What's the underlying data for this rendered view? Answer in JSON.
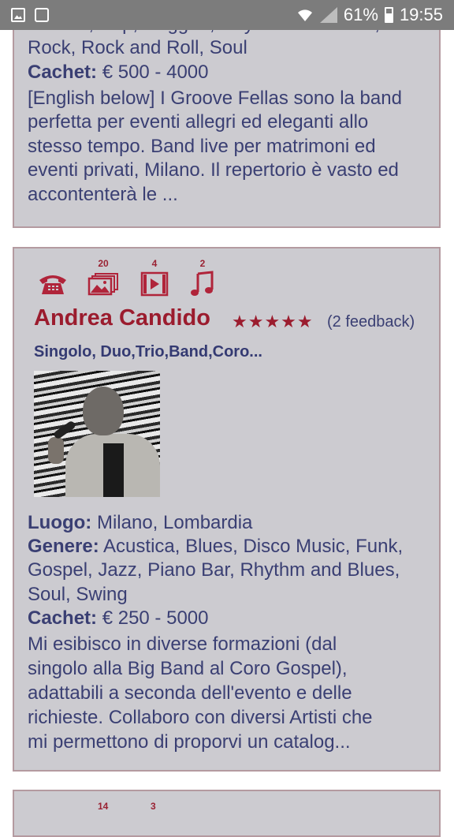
{
  "statusbar": {
    "battery_pct": "61%",
    "time": "19:55"
  },
  "card1": {
    "genre_tail": "Italiana, Pop, Reggae, Rhythm and Blues,",
    "genre_line2": "Rock, Rock and Roll, Soul",
    "cachet_label": "Cachet:",
    "cachet_value": "€ 500 - 4000",
    "desc_lines": [
      "[English below] I Groove Fellas sono la band",
      "perfetta per eventi allegri ed eleganti allo",
      "stesso tempo. Band live per matrimoni ed",
      "eventi privati, Milano. Il repertorio è vasto ed",
      "accontenterà le ..."
    ]
  },
  "card2": {
    "icons": [
      {
        "name": "phone-icon",
        "count": ""
      },
      {
        "name": "photos-icon",
        "count": "20"
      },
      {
        "name": "video-icon",
        "count": "4"
      },
      {
        "name": "music-note-icon",
        "count": "2"
      }
    ],
    "name": "Andrea Candido",
    "rating": 5,
    "stars": "★★★★★",
    "feedback": "(2 feedback)",
    "formations": "Singolo, Duo,Trio,Band,Coro...",
    "luogo_label": "Luogo:",
    "luogo_value": "Milano, Lombardia",
    "genere_label": "Genere:",
    "genere_line1": "Acustica, Blues, Disco Music, Funk,",
    "genere_line2": "Gospel, Jazz, Piano Bar, Rhythm and Blues,",
    "genere_line3": "Soul, Swing",
    "cachet_label": "Cachet:",
    "cachet_value": "€ 250 - 5000",
    "desc_lines": [
      "Mi esibisco in diverse formazioni (dal",
      "singolo alla Big Band al Coro Gospel),",
      "adattabili a seconda dell'evento e delle",
      "richieste. Collaboro con diversi Artisti che",
      "mi permettono di proporvi un catalog..."
    ]
  },
  "card3": {
    "icon_counts": [
      "14",
      "3"
    ]
  },
  "colors": {
    "card_bg": "#cccbd0",
    "card_border": "#b49aa0",
    "accent_red": "#9b1c2e",
    "text_navy": "#3a3f73",
    "statusbar_bg": "#7c7c7c"
  }
}
